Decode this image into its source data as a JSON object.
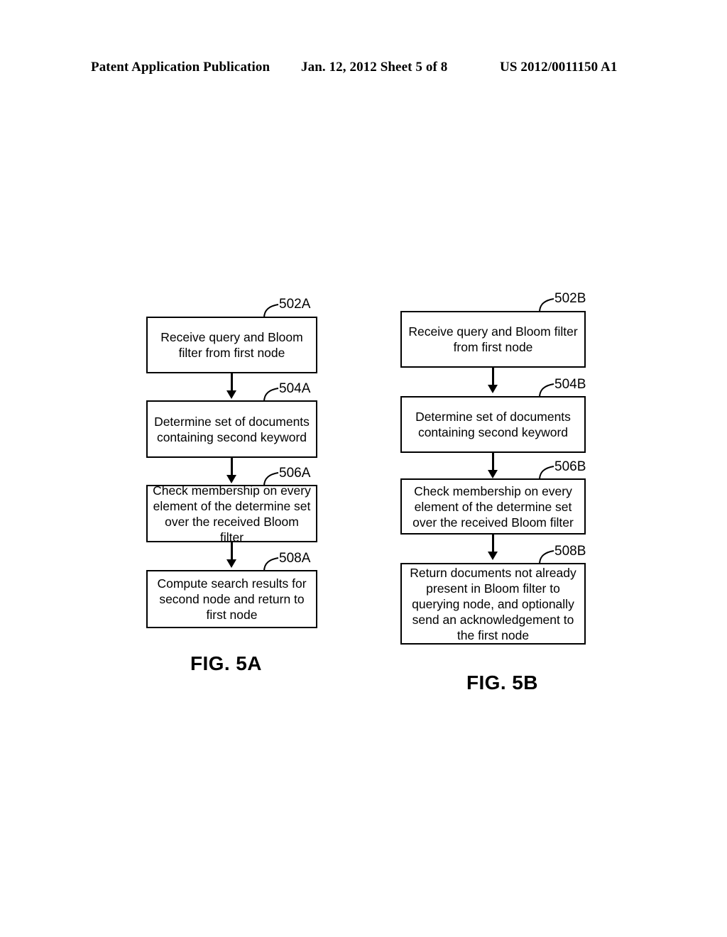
{
  "header": {
    "publication": "Patent Application Publication",
    "date_sheet": "Jan. 12, 2012  Sheet 5 of 8",
    "patent_number": "US 2012/0011150 A1"
  },
  "figures": [
    {
      "caption": "FIG. 5A",
      "boxes": [
        {
          "ref": "502A",
          "text": "Receive query and Bloom filter from first node"
        },
        {
          "ref": "504A",
          "text": "Determine set of documents containing second keyword"
        },
        {
          "ref": "506A",
          "text": "Check membership on every element of the determine set over the received Bloom filter"
        },
        {
          "ref": "508A",
          "text": "Compute search results for second node and return to first node"
        }
      ]
    },
    {
      "caption": "FIG. 5B",
      "boxes": [
        {
          "ref": "502B",
          "text": "Receive query and Bloom filter from first node"
        },
        {
          "ref": "504B",
          "text": "Determine set of documents containing second keyword"
        },
        {
          "ref": "506B",
          "text": "Check membership on every element of the determine set over the received Bloom filter"
        },
        {
          "ref": "508B",
          "text": "Return documents not already present in Bloom filter to querying node, and optionally send an acknowledgement to the first node"
        }
      ]
    }
  ],
  "colors": {
    "ink": "#000000",
    "paper": "#ffffff"
  }
}
